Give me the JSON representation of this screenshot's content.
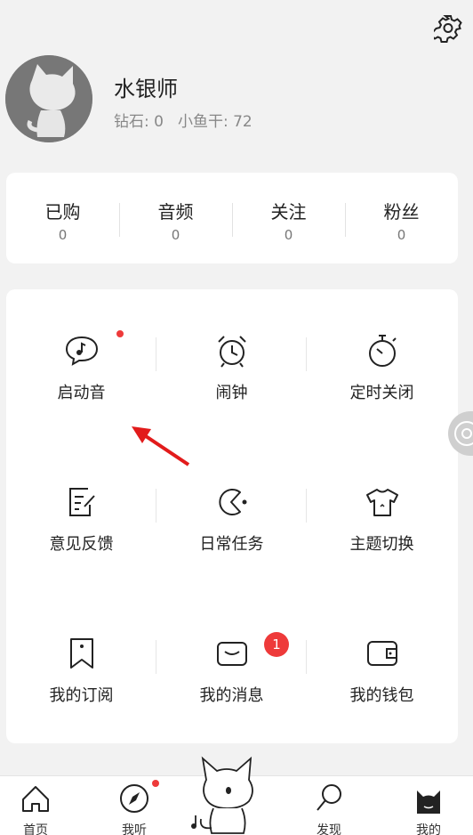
{
  "profile": {
    "name": "水银师",
    "diamonds": "钻石: 0",
    "fish": "小鱼干: 72"
  },
  "counts": [
    {
      "label": "已购",
      "value": "0"
    },
    {
      "label": "音频",
      "value": "0"
    },
    {
      "label": "关注",
      "value": "0"
    },
    {
      "label": "粉丝",
      "value": "0"
    }
  ],
  "menu": {
    "startup_sound": "启动音",
    "alarm": "闹钟",
    "timer_off": "定时关闭",
    "feedback": "意见反馈",
    "daily_tasks": "日常任务",
    "theme_switch": "主题切换",
    "subscriptions": "我的订阅",
    "messages": "我的消息",
    "messages_badge": "1",
    "wallet": "我的钱包"
  },
  "tabs": {
    "home": "首页",
    "listen": "我听",
    "discover": "发现",
    "mine": "我的"
  },
  "colors": {
    "accent_red": "#ee3a3a",
    "background": "#f2f2f2",
    "card": "#ffffff"
  }
}
